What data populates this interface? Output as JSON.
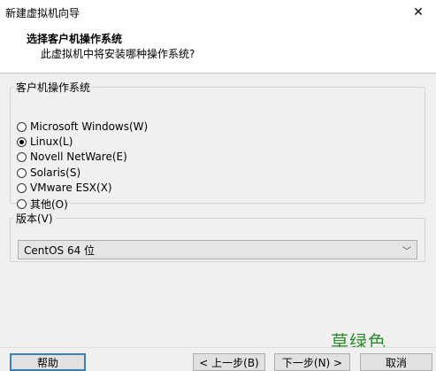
{
  "window": {
    "title": "新建虚拟机向导",
    "close_glyph": "✕"
  },
  "header": {
    "title": "选择客户机操作系统",
    "subtitle": "此虚拟机中将安装哪种操作系统?"
  },
  "os_group": {
    "legend": "客户机操作系统",
    "options": [
      {
        "label": "Microsoft Windows(W)",
        "checked": false
      },
      {
        "label": "Linux(L)",
        "checked": true
      },
      {
        "label": "Novell NetWare(E)",
        "checked": false
      },
      {
        "label": "Solaris(S)",
        "checked": false
      },
      {
        "label": "VMware ESX(X)",
        "checked": false
      },
      {
        "label": "其他(O)",
        "checked": false
      }
    ]
  },
  "version_group": {
    "legend": "版本(V)",
    "selected": "CentOS 64 位",
    "chevron_glyph": "﹀"
  },
  "watermark": "草绿色",
  "buttons": {
    "help": "帮助",
    "back": "< 上一步(B)",
    "next": "下一步(N) >",
    "cancel": "取消"
  },
  "icons": {
    "close": "close-icon",
    "dropdown": "chevron-down-icon"
  }
}
